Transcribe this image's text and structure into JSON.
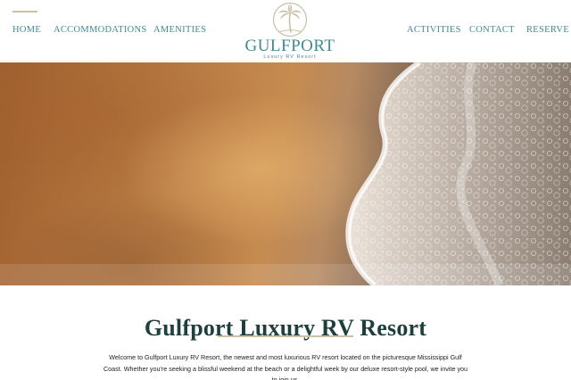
{
  "nav": {
    "home": "HOME",
    "accommodations": "ACCOMMODATIONS",
    "amenities": "AMENITIES",
    "activities": "ACTIVITIES",
    "contact": "CONTACT",
    "reserve": "RESERVE"
  },
  "logo": {
    "name": "GULFPORT",
    "tagline": "Luxury RV Resort",
    "icon": "palm-tree-icon"
  },
  "hero": {
    "image": "beach-sand-wave-photo"
  },
  "main": {
    "title": "Gulfport Luxury RV Resort",
    "intro": "Welcome to Gulfport Luxury RV Resort, the newest and most luxurious RV resort located on the picturesque Mississippi Gulf Coast. Whether you're seeking a blissful weekend at the beach or a delightful week by our deluxe resort-style pool, we invite you to join us."
  },
  "colors": {
    "brand_teal": "#3f8a90",
    "accent_gold": "#c9c1a3",
    "heading_dark": "#1f3f3c"
  }
}
